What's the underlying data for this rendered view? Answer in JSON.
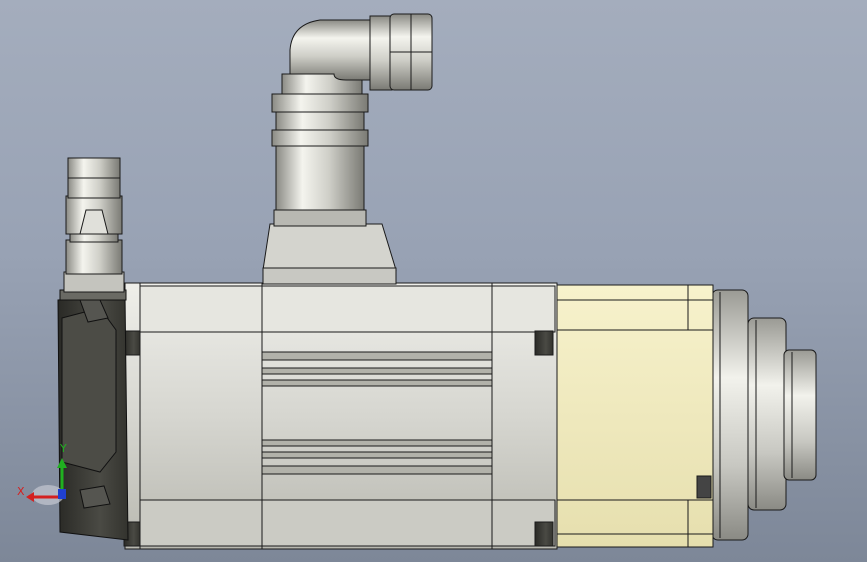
{
  "viewport": {
    "background_top": "#a4adbd",
    "background_bottom": "#7d8798"
  },
  "model": {
    "description_icon": "servo-motor-cad-model",
    "colors": {
      "housing": "#d8d8d2",
      "flange": "#f2ecc0",
      "endcap": "#3b3b36",
      "connector": "#d0d0ca",
      "outline": "#1a1a1a"
    }
  },
  "triad": {
    "x_label": "X",
    "y_label": "Y",
    "x_color": "#d42020",
    "y_color": "#20b020",
    "z_color": "#2040d0"
  }
}
